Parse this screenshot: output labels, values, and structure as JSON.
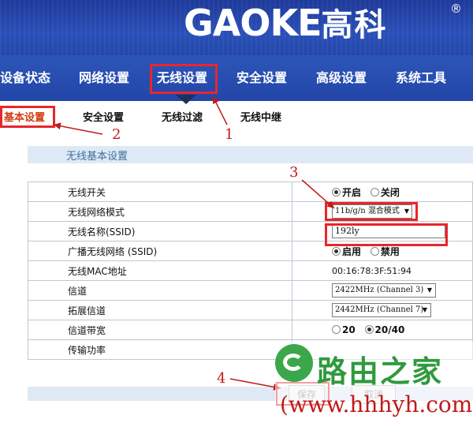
{
  "brand": {
    "name": "GAOKE",
    "cn": "高科",
    "reg": "®"
  },
  "nav": {
    "items": [
      {
        "label": "设备状态"
      },
      {
        "label": "网络设置"
      },
      {
        "label": "无线设置"
      },
      {
        "label": "安全设置"
      },
      {
        "label": "高级设置"
      },
      {
        "label": "系统工具"
      }
    ],
    "active_index": 2
  },
  "subnav": {
    "items": [
      {
        "label": "基本设置"
      },
      {
        "label": "安全设置"
      },
      {
        "label": "无线过滤"
      },
      {
        "label": "无线中继"
      }
    ],
    "active_index": 0
  },
  "section": {
    "title": "无线基本设置"
  },
  "settings": {
    "wireless_switch": {
      "label": "无线开关",
      "on": "开启",
      "off": "关闭",
      "selected": "开启"
    },
    "mode": {
      "label": "无线网络模式",
      "value": "11b/g/n 混合模式"
    },
    "ssid": {
      "label": "无线名称(SSID)",
      "value": "192ly"
    },
    "broadcast": {
      "label": "广播无线网络 (SSID)",
      "enable": "启用",
      "disable": "禁用",
      "selected": "启用"
    },
    "mac": {
      "label": "无线MAC地址",
      "value": "00:16:78:3F:51:94"
    },
    "channel": {
      "label": "信道",
      "value": "2422MHz (Channel 3)"
    },
    "ext_channel": {
      "label": "拓展信道",
      "value": "2442MHz (Channel 7)"
    },
    "bandwidth": {
      "label": "信道带宽",
      "opt1": "20",
      "opt2": "20/40",
      "selected": "20/40"
    },
    "tx_power": {
      "label": "传输功率"
    }
  },
  "buttons": {
    "save": "保存",
    "cancel": "取消"
  },
  "annotations": {
    "n1": "1",
    "n2": "2",
    "n3": "3",
    "n4": "4"
  },
  "watermark": {
    "site_name": "路由之家",
    "url": "(www.hhhyh.com)"
  },
  "colors": {
    "header": "#2348a8",
    "annotation_red": "#e8262b",
    "section_bar": "#dfe9f5",
    "watermark_green": "#2f9a3c"
  }
}
